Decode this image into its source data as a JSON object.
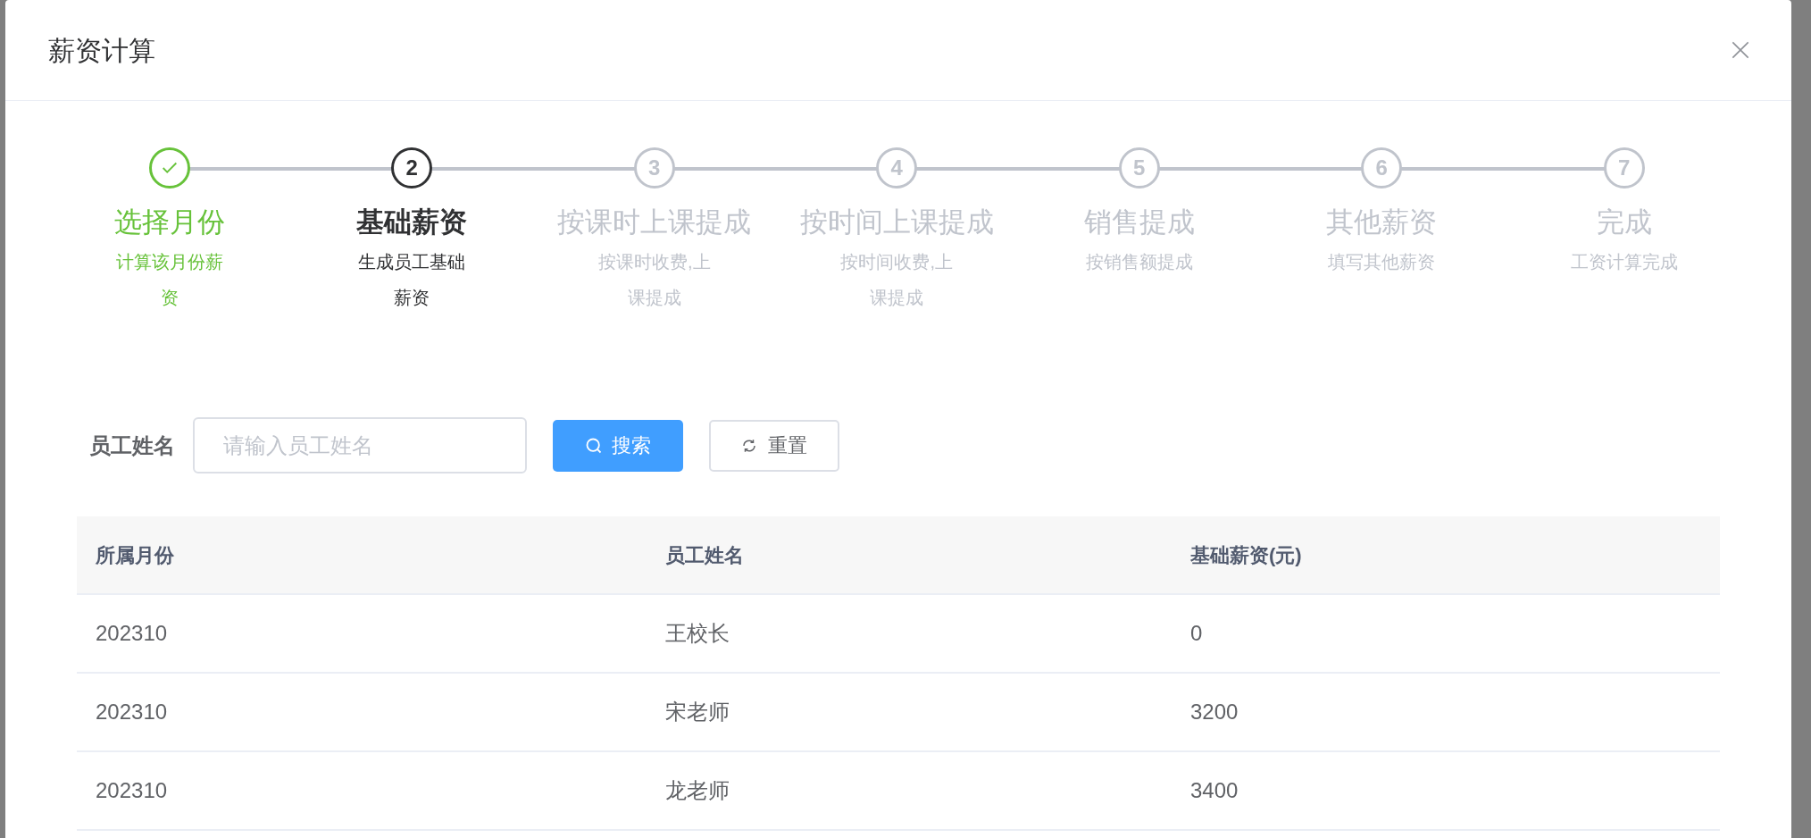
{
  "dialog": {
    "title": "薪资计算"
  },
  "steps": [
    {
      "title": "选择月份",
      "description": "计算该月份薪资",
      "completed": true,
      "active": false
    },
    {
      "number": "2",
      "title": "基础薪资",
      "description": "生成员工基础薪资",
      "completed": false,
      "active": true
    },
    {
      "number": "3",
      "title": "按课时上课提成",
      "description": "按课时收费,上课提成",
      "completed": false,
      "active": false
    },
    {
      "number": "4",
      "title": "按时间上课提成",
      "description": "按时间收费,上课提成",
      "completed": false,
      "active": false
    },
    {
      "number": "5",
      "title": "销售提成",
      "description": "按销售额提成",
      "completed": false,
      "active": false
    },
    {
      "number": "6",
      "title": "其他薪资",
      "description": "填写其他薪资",
      "completed": false,
      "active": false
    },
    {
      "number": "7",
      "title": "完成",
      "description": "工资计算完成",
      "completed": false,
      "active": false
    }
  ],
  "search_form": {
    "label": "员工姓名",
    "placeholder": "请输入员工姓名",
    "search_button": "搜索",
    "reset_button": "重置"
  },
  "table": {
    "columns": [
      "所属月份",
      "员工姓名",
      "基础薪资(元)"
    ],
    "rows": [
      [
        "202310",
        "王校长",
        "0"
      ],
      [
        "202310",
        "宋老师",
        "3200"
      ],
      [
        "202310",
        "龙老师",
        "3400"
      ]
    ]
  }
}
